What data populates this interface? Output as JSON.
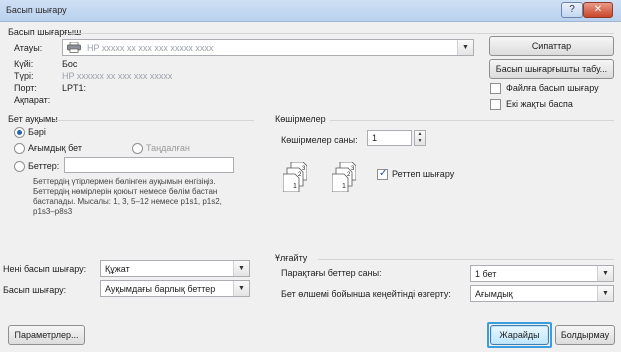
{
  "window": {
    "title": "Басып шығару",
    "help_glyph": "?",
    "close_glyph": "✕"
  },
  "printer_group": {
    "label": "Басып шығарғыш",
    "name_label": "Атауы:",
    "name_value": "HP xxxxx xx xxx xxx xxxxx xxxx",
    "status_label": "Күйі:",
    "status_value": "Бос",
    "type_label": "Түрі:",
    "type_value": "HP xxxxxx xx xxx xxx xxxxx",
    "port_label": "Порт:",
    "port_value": "LPT1:",
    "comment_label": "Ақпарат:",
    "properties_button": "Сипаттар",
    "find_printer_button": "Басып шығарғышты табу...",
    "print_to_file_label": "Файлға басып шығару",
    "print_to_file_checked": false,
    "manual_duplex_label": "Екі жақты баспа",
    "manual_duplex_checked": false
  },
  "page_range": {
    "label": "Бет ауқымы",
    "all_label": "Бәрі",
    "current_page_label": "Ағымдық бет",
    "selection_label": "Таңдалған",
    "pages_label": "Беттер:",
    "pages_value": "",
    "hint_line1": "Беттердің үтірлермен бөлінген ауқымын енгізіңіз.",
    "hint_line2": "Беттердің нөмірлерін қоюыт немесе бөлім бастан",
    "hint_line3": "бастапады. Мысалы: 1, 3, 5–12 немесе p1s1, p1s2,",
    "hint_line4": "p1s3–p8s3"
  },
  "copies": {
    "label": "Көшірмелер",
    "count_label": "Көшірмелер саны:",
    "count_value": "1",
    "collate_label": "Реттеп шығару",
    "collate_checked": true,
    "page_numbers": [
      "1",
      "2",
      "3",
      "1",
      "2",
      "3"
    ]
  },
  "print_what": {
    "label": "Нені басып шығару:",
    "value": "Құжат"
  },
  "print_mode": {
    "label": "Басып шығару:",
    "value": "Ауқымдағы барлық беттер"
  },
  "zoom": {
    "label": "Ұлғайту",
    "pages_per_sheet_label": "Парақтағы беттер саны:",
    "pages_per_sheet_value": "1 бет",
    "scale_label": "Бет өлшемі бойынша кеңейтінді өзгерту:",
    "scale_value": "Ағымдық"
  },
  "footer": {
    "options_button": "Параметрлер...",
    "ok_button": "Жарайды",
    "cancel_button": "Болдырмау"
  },
  "colors": {
    "accent": "#3a9de0"
  }
}
